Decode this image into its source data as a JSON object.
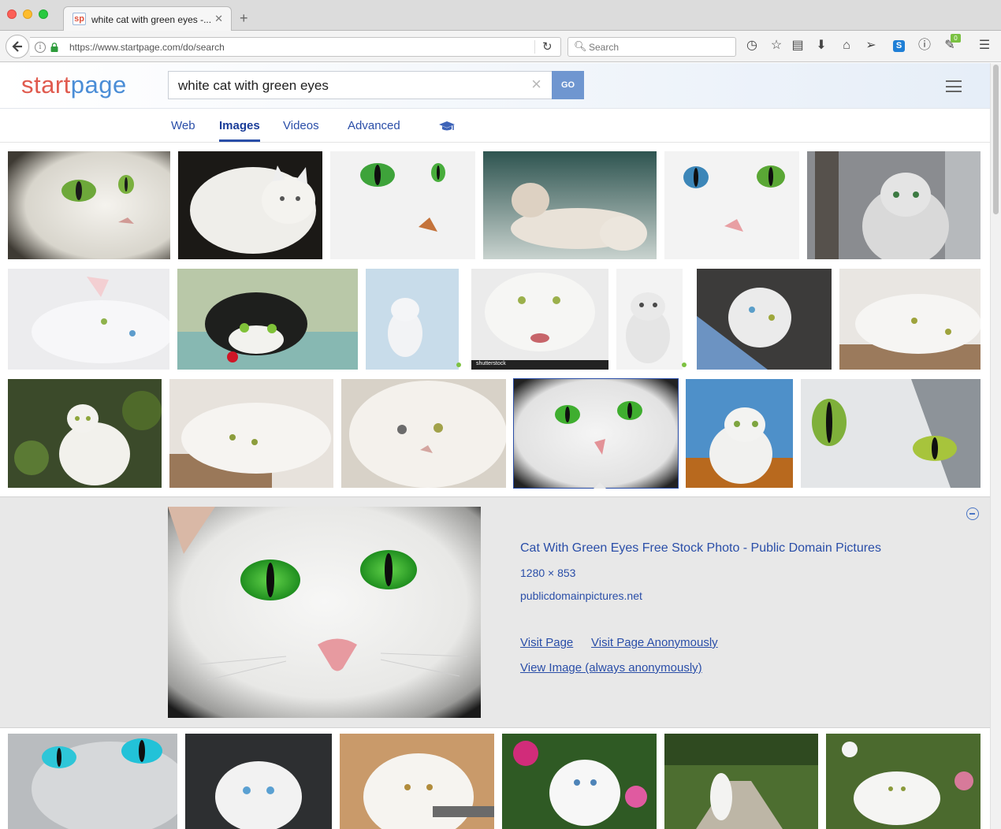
{
  "browser": {
    "tab_title": "white cat with green eyes -...",
    "tab_favicon": "sp",
    "url": "https://www.startpage.com/do/search",
    "search_placeholder": "Search",
    "addon_badge": "0"
  },
  "site": {
    "logo_start": "start",
    "logo_page": "page",
    "query": "white cat with green eyes",
    "go_label": "GO"
  },
  "nav_tabs": [
    {
      "label": "Web",
      "active": false
    },
    {
      "label": "Images",
      "active": true
    },
    {
      "label": "Videos",
      "active": false
    },
    {
      "label": "Advanced",
      "active": false
    }
  ],
  "thumbnails": [
    {
      "label": "shutterstock"
    }
  ],
  "preview": {
    "title": "Cat With Green Eyes Free Stock Photo - Public Domain Pictures",
    "dimensions": "1280 × 853",
    "domain": "publicdomainpictures.net",
    "visit_page": "Visit Page",
    "visit_anon": "Visit Page Anonymously",
    "view_image": "View Image (always anonymously)"
  },
  "colors": {
    "link": "#2a4ea8",
    "logo_red": "#e05a4e",
    "logo_blue": "#4a8dd6",
    "go_button": "#6f96d0"
  }
}
